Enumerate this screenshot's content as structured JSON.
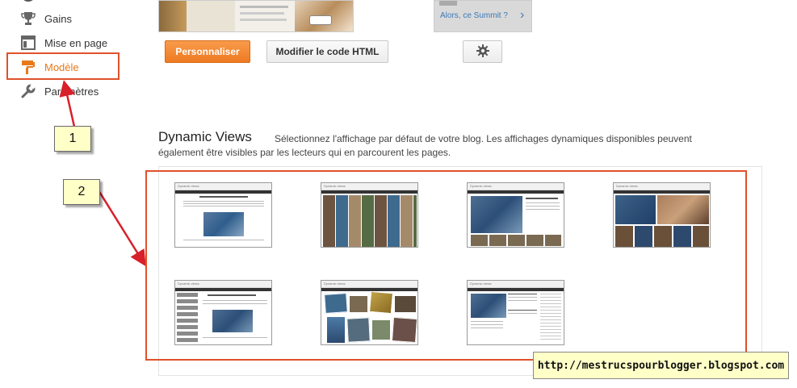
{
  "sidebar": {
    "items": [
      {
        "label": "Gains",
        "icon": "trophy-icon"
      },
      {
        "label": "Mise en page",
        "icon": "layout-icon"
      },
      {
        "label": "Modèle",
        "icon": "paint-roller-icon",
        "active": true
      },
      {
        "label": "Paramètres",
        "icon": "wrench-icon"
      }
    ]
  },
  "callouts": {
    "one": "1",
    "two": "2"
  },
  "toolbar": {
    "customize_label": "Personnaliser",
    "edit_html_label": "Modifier le code HTML"
  },
  "preview_mobile": {
    "text": "Alors, ce Summit ?"
  },
  "dynamic_views": {
    "title": "Dynamic Views",
    "description": "Sélectionnez l'affichage par défaut de votre blog. Les affichages dynamiques disponibles peuvent également être visibles par les lecteurs qui en parcourent les pages.",
    "thumb_header": "Dynamic views",
    "thumbs": [
      {
        "kind": "classic"
      },
      {
        "kind": "flipcard"
      },
      {
        "kind": "magazine"
      },
      {
        "kind": "mosaic"
      },
      {
        "kind": "sidebar"
      },
      {
        "kind": "snapshot"
      },
      {
        "kind": "timeslide"
      }
    ]
  },
  "watermark": {
    "url": "http://mestrucspourblogger.blogspot.com"
  },
  "colors": {
    "accent": "#e8791b",
    "annotation_red": "#e0512b",
    "callout_bg": "#ffffc8"
  }
}
